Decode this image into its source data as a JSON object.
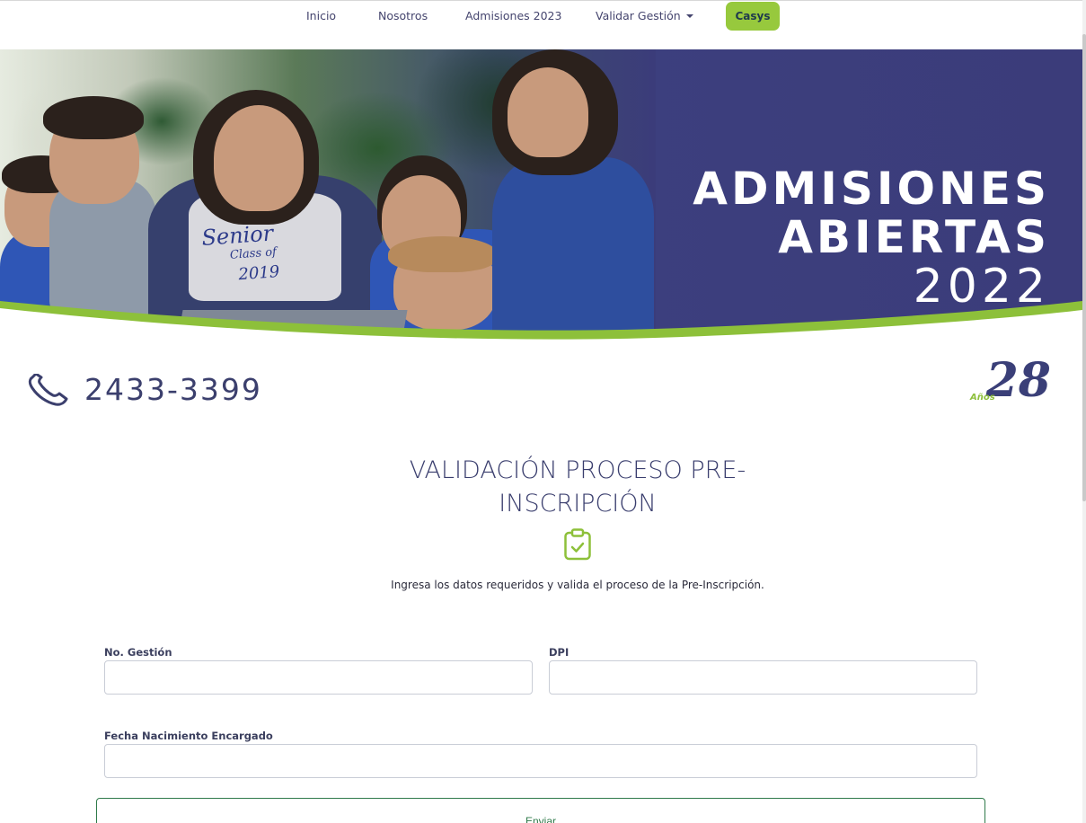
{
  "nav": {
    "items": [
      {
        "label": "Inicio"
      },
      {
        "label": "Nosotros"
      },
      {
        "label": "Admisiones 2023"
      },
      {
        "label": "Validar Gestión"
      }
    ],
    "cta_label": "Casys"
  },
  "hero": {
    "line1": "ADMISIONES",
    "line2": "ABIERTAS",
    "line3": "2022",
    "shirt_text_1": "Senior",
    "shirt_text_2": "Class of",
    "shirt_text_3": "2019"
  },
  "contact": {
    "phone": "2433-3399"
  },
  "anniversary": {
    "number": "28",
    "label": "Años"
  },
  "form": {
    "title": "VALIDACIÓN PROCESO PRE-INSCRIPCIÓN",
    "subtitle": "Ingresa los datos requeridos y valida el proceso de la Pre-Inscripción.",
    "fields": [
      {
        "label": "No. Gestión",
        "value": "",
        "placeholder": ""
      },
      {
        "label": "DPI",
        "value": "",
        "placeholder": ""
      },
      {
        "label": "Fecha Nacimiento Encargado",
        "value": "",
        "placeholder": ""
      }
    ],
    "submit_label": "Enviar"
  },
  "colors": {
    "brand_navy": "#3b3c7a",
    "brand_green": "#97c93d",
    "submit_green": "#2f7a4a"
  },
  "icons": {
    "phone": "phone-icon",
    "clipboard": "clipboard-check-icon",
    "caret": "caret-down-icon"
  }
}
